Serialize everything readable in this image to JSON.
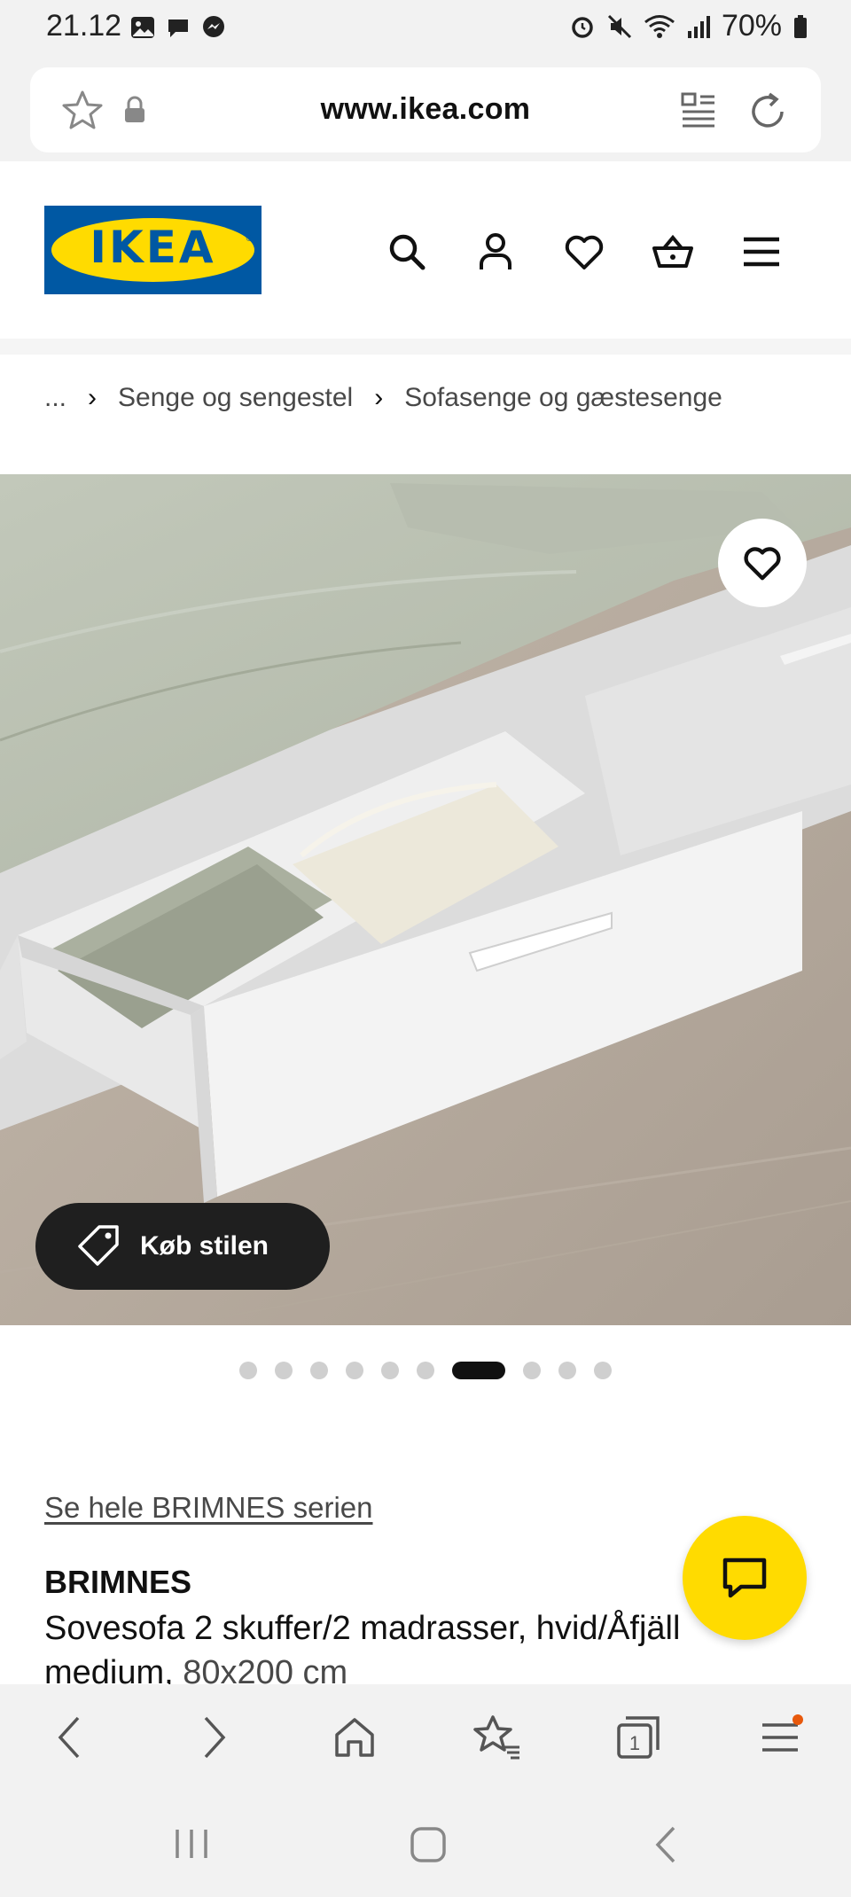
{
  "status_bar": {
    "time": "21.12",
    "battery": "70%"
  },
  "browser": {
    "url": "www.ikea.com"
  },
  "header": {
    "logo_text": "IKEA",
    "colors": {
      "brand_blue": "#0058a3",
      "brand_yellow": "#ffdb00"
    }
  },
  "breadcrumb": {
    "ellipsis": "...",
    "items": [
      "Senge og sengestel",
      "Sofasenge og gæstesenge"
    ]
  },
  "gallery": {
    "shop_style_label": "Køb stilen",
    "dot_count": 10,
    "active_dot_index": 6
  },
  "product": {
    "series_link": "Se hele BRIMNES serien",
    "brand": "BRIMNES",
    "description": "Sovesofa 2 skuffer/2 madrasser, hvid/Åfjäll medium,",
    "size": "80x200 cm"
  },
  "bottom_nav": {
    "tab_count": "1"
  }
}
